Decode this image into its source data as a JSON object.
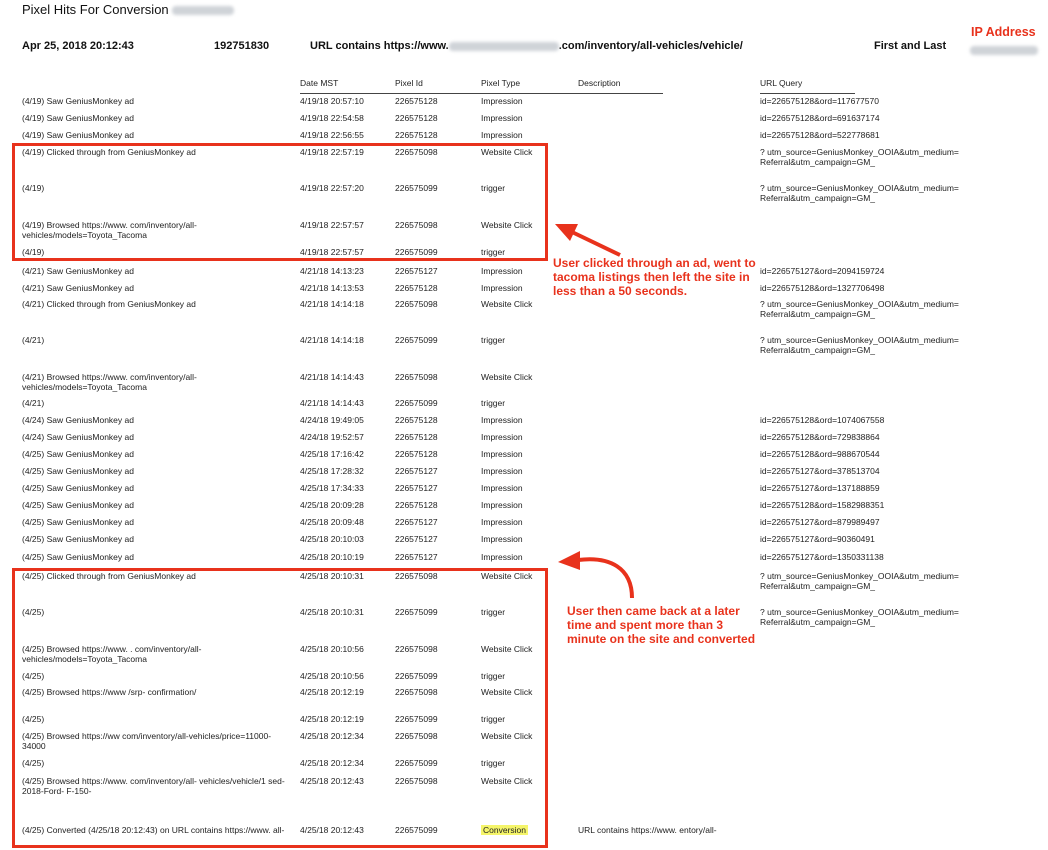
{
  "title": "Pixel Hits For Conversion",
  "header": {
    "date": "Apr 25, 2018 20:12:43",
    "id": "192751830",
    "url_prefix": "URL contains https://www.",
    "url_suffix": ".com/inventory/all-vehicles/vehicle/",
    "first_last": "First and Last",
    "ip_label": "IP Address"
  },
  "columns": {
    "date": "Date MST",
    "pixel_id": "Pixel Id",
    "pixel_type": "Pixel Type",
    "description": "Description",
    "url_query": "URL Query"
  },
  "rows": [
    {
      "event": "(4/19) Saw GeniusMonkey ad",
      "date": "4/19/18 20:57:10",
      "pixel": "226575128",
      "type": "Impression",
      "desc": "",
      "query": "id=226575128&ord=117677570"
    },
    {
      "event": "(4/19) Saw GeniusMonkey ad",
      "date": "4/19/18 22:54:58",
      "pixel": "226575128",
      "type": "Impression",
      "desc": "",
      "query": "id=226575128&ord=691637174"
    },
    {
      "event": "(4/19) Saw GeniusMonkey ad",
      "date": "4/19/18 22:56:55",
      "pixel": "226575128",
      "type": "Impression",
      "desc": "",
      "query": "id=226575128&ord=522778681"
    },
    {
      "event": "(4/19) Clicked through from GeniusMonkey ad",
      "date": "4/19/18 22:57:19",
      "pixel": "226575098",
      "type": "Website Click",
      "desc": "",
      "query": "? utm_source=GeniusMonkey_OOIA&utm_medium= Referral&utm_campaign=GM_"
    },
    {
      "event": "(4/19)",
      "date": "4/19/18 22:57:20",
      "pixel": "226575099",
      "type": "trigger",
      "desc": "",
      "query": "? utm_source=GeniusMonkey_OOIA&utm_medium= Referral&utm_campaign=GM_"
    },
    {
      "event": "(4/19) Browsed https://www. com/inventory/all-vehicles/models=Toyota_Tacoma",
      "date": "4/19/18 22:57:57",
      "pixel": "226575098",
      "type": "Website Click",
      "desc": "",
      "query": ""
    },
    {
      "event": "(4/19)",
      "date": "4/19/18 22:57:57",
      "pixel": "226575099",
      "type": "trigger",
      "desc": "",
      "query": ""
    },
    {
      "event": "(4/21) Saw GeniusMonkey ad",
      "date": "4/21/18 14:13:23",
      "pixel": "226575127",
      "type": "Impression",
      "desc": "",
      "query": "id=226575127&ord=2094159724"
    },
    {
      "event": "(4/21) Saw GeniusMonkey ad",
      "date": "4/21/18 14:13:53",
      "pixel": "226575128",
      "type": "Impression",
      "desc": "",
      "query": "id=226575128&ord=1327706498"
    },
    {
      "event": "(4/21) Clicked through from GeniusMonkey ad",
      "date": "4/21/18 14:14:18",
      "pixel": "226575098",
      "type": "Website Click",
      "desc": "",
      "query": "? utm_source=GeniusMonkey_OOIA&utm_medium= Referral&utm_campaign=GM_"
    },
    {
      "event": "(4/21)",
      "date": "4/21/18 14:14:18",
      "pixel": "226575099",
      "type": "trigger",
      "desc": "",
      "query": "? utm_source=GeniusMonkey_OOIA&utm_medium= Referral&utm_campaign=GM_"
    },
    {
      "event": "(4/21) Browsed https://www. com/inventory/all-vehicles/models=Toyota_Tacoma",
      "date": "4/21/18 14:14:43",
      "pixel": "226575098",
      "type": "Website Click",
      "desc": "",
      "query": ""
    },
    {
      "event": "(4/21)",
      "date": "4/21/18 14:14:43",
      "pixel": "226575099",
      "type": "trigger",
      "desc": "",
      "query": ""
    },
    {
      "event": "(4/24) Saw GeniusMonkey ad",
      "date": "4/24/18 19:49:05",
      "pixel": "226575128",
      "type": "Impression",
      "desc": "",
      "query": "id=226575128&ord=1074067558"
    },
    {
      "event": "(4/24) Saw GeniusMonkey ad",
      "date": "4/24/18 19:52:57",
      "pixel": "226575128",
      "type": "Impression",
      "desc": "",
      "query": "id=226575128&ord=729838864"
    },
    {
      "event": "(4/25) Saw GeniusMonkey ad",
      "date": "4/25/18 17:16:42",
      "pixel": "226575128",
      "type": "Impression",
      "desc": "",
      "query": "id=226575128&ord=988670544"
    },
    {
      "event": "(4/25) Saw GeniusMonkey ad",
      "date": "4/25/18 17:28:32",
      "pixel": "226575127",
      "type": "Impression",
      "desc": "",
      "query": "id=226575127&ord=378513704"
    },
    {
      "event": "(4/25) Saw GeniusMonkey ad",
      "date": "4/25/18 17:34:33",
      "pixel": "226575127",
      "type": "Impression",
      "desc": "",
      "query": "id=226575127&ord=137188859"
    },
    {
      "event": "(4/25) Saw GeniusMonkey ad",
      "date": "4/25/18 20:09:28",
      "pixel": "226575128",
      "type": "Impression",
      "desc": "",
      "query": "id=226575128&ord=1582988351"
    },
    {
      "event": "(4/25) Saw GeniusMonkey ad",
      "date": "4/25/18 20:09:48",
      "pixel": "226575127",
      "type": "Impression",
      "desc": "",
      "query": "id=226575127&ord=879989497"
    },
    {
      "event": "(4/25) Saw GeniusMonkey ad",
      "date": "4/25/18 20:10:03",
      "pixel": "226575127",
      "type": "Impression",
      "desc": "",
      "query": "id=226575127&ord=90360491"
    },
    {
      "event": "(4/25) Saw GeniusMonkey ad",
      "date": "4/25/18 20:10:19",
      "pixel": "226575127",
      "type": "Impression",
      "desc": "",
      "query": "id=226575127&ord=1350331138"
    },
    {
      "event": "(4/25) Clicked through from GeniusMonkey ad",
      "date": "4/25/18 20:10:31",
      "pixel": "226575098",
      "type": "Website Click",
      "desc": "",
      "query": "? utm_source=GeniusMonkey_OOIA&utm_medium= Referral&utm_campaign=GM_"
    },
    {
      "event": "(4/25)",
      "date": "4/25/18 20:10:31",
      "pixel": "226575099",
      "type": "trigger",
      "desc": "",
      "query": "? utm_source=GeniusMonkey_OOIA&utm_medium= Referral&utm_campaign=GM_"
    },
    {
      "event": "(4/25) Browsed https://www. . com/inventory/all-vehicles/models=Toyota_Tacoma",
      "date": "4/25/18 20:10:56",
      "pixel": "226575098",
      "type": "Website Click",
      "desc": "",
      "query": ""
    },
    {
      "event": "(4/25)",
      "date": "4/25/18 20:10:56",
      "pixel": "226575099",
      "type": "trigger",
      "desc": "",
      "query": ""
    },
    {
      "event": "(4/25) Browsed https://www /srp- confirmation/",
      "date": "4/25/18 20:12:19",
      "pixel": "226575098",
      "type": "Website Click",
      "desc": "",
      "query": ""
    },
    {
      "event": "(4/25)",
      "date": "4/25/18 20:12:19",
      "pixel": "226575099",
      "type": "trigger",
      "desc": "",
      "query": ""
    },
    {
      "event": "(4/25) Browsed https://ww com/inventory/all-vehicles/price=11000-34000",
      "date": "4/25/18 20:12:34",
      "pixel": "226575098",
      "type": "Website Click",
      "desc": "",
      "query": ""
    },
    {
      "event": "(4/25)",
      "date": "4/25/18 20:12:34",
      "pixel": "226575099",
      "type": "trigger",
      "desc": "",
      "query": ""
    },
    {
      "event": "(4/25) Browsed https://www. com/inventory/all- vehicles/vehicle/1 sed-2018-Ford- F-150-",
      "date": "4/25/18 20:12:43",
      "pixel": "226575098",
      "type": "Website Click",
      "desc": "",
      "query": ""
    },
    {
      "event": "(4/25) Converted (4/25/18 20:12:43) on URL contains https://www. all-",
      "date": "4/25/18 20:12:43",
      "pixel": "226575099",
      "type": "Conversion",
      "desc": "URL contains https://www. entory/all-",
      "query": ""
    }
  ],
  "annotations": {
    "note1": "User clicked through an ad, went to tacoma listings then left the site in less than a 50 seconds.",
    "note2": "User then came back at a later time and spent more than 3 minute on the site and converted"
  },
  "colors": {
    "accent": "#e8321c",
    "highlight": "#f5f56a"
  }
}
